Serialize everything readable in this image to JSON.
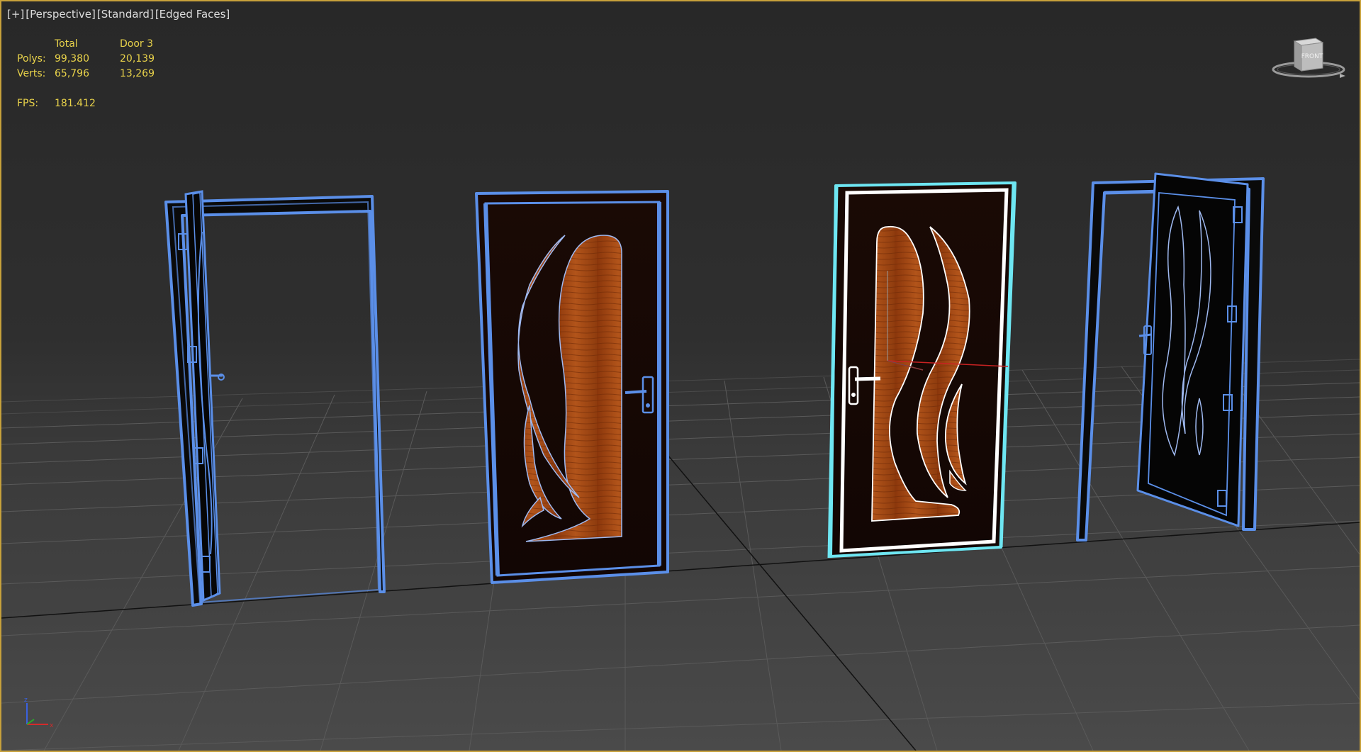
{
  "viewport": {
    "labels": [
      "[+]",
      "[Perspective]",
      "[Standard]",
      "[Edged Faces]"
    ],
    "border_color": "#c7a13b"
  },
  "stats": {
    "header_total": "Total",
    "header_object": "Door 3",
    "polys_label": "Polys:",
    "polys_total": "99,380",
    "polys_object": "20,139",
    "verts_label": "Verts:",
    "verts_total": "65,796",
    "verts_object": "13,269",
    "fps_label": "FPS:",
    "fps_value": "181.412",
    "color": "#e8d24a"
  },
  "viewcube": {
    "face_label": "FRONT",
    "icon": "viewcube-icon"
  },
  "axis_gizmo": {
    "z_label": "z",
    "x_label": "x",
    "icon": "axis-tripod-icon"
  },
  "scene": {
    "objects": [
      {
        "name": "door-1-open-left",
        "selected": false
      },
      {
        "name": "door-2-closed",
        "selected": false
      },
      {
        "name": "door-3-closed-selected",
        "selected": true
      },
      {
        "name": "door-4-open-right",
        "selected": false
      }
    ],
    "wire_color": "#5b8fe8",
    "selected_color": "#6ee6f2",
    "wood_color": "#a84812"
  }
}
